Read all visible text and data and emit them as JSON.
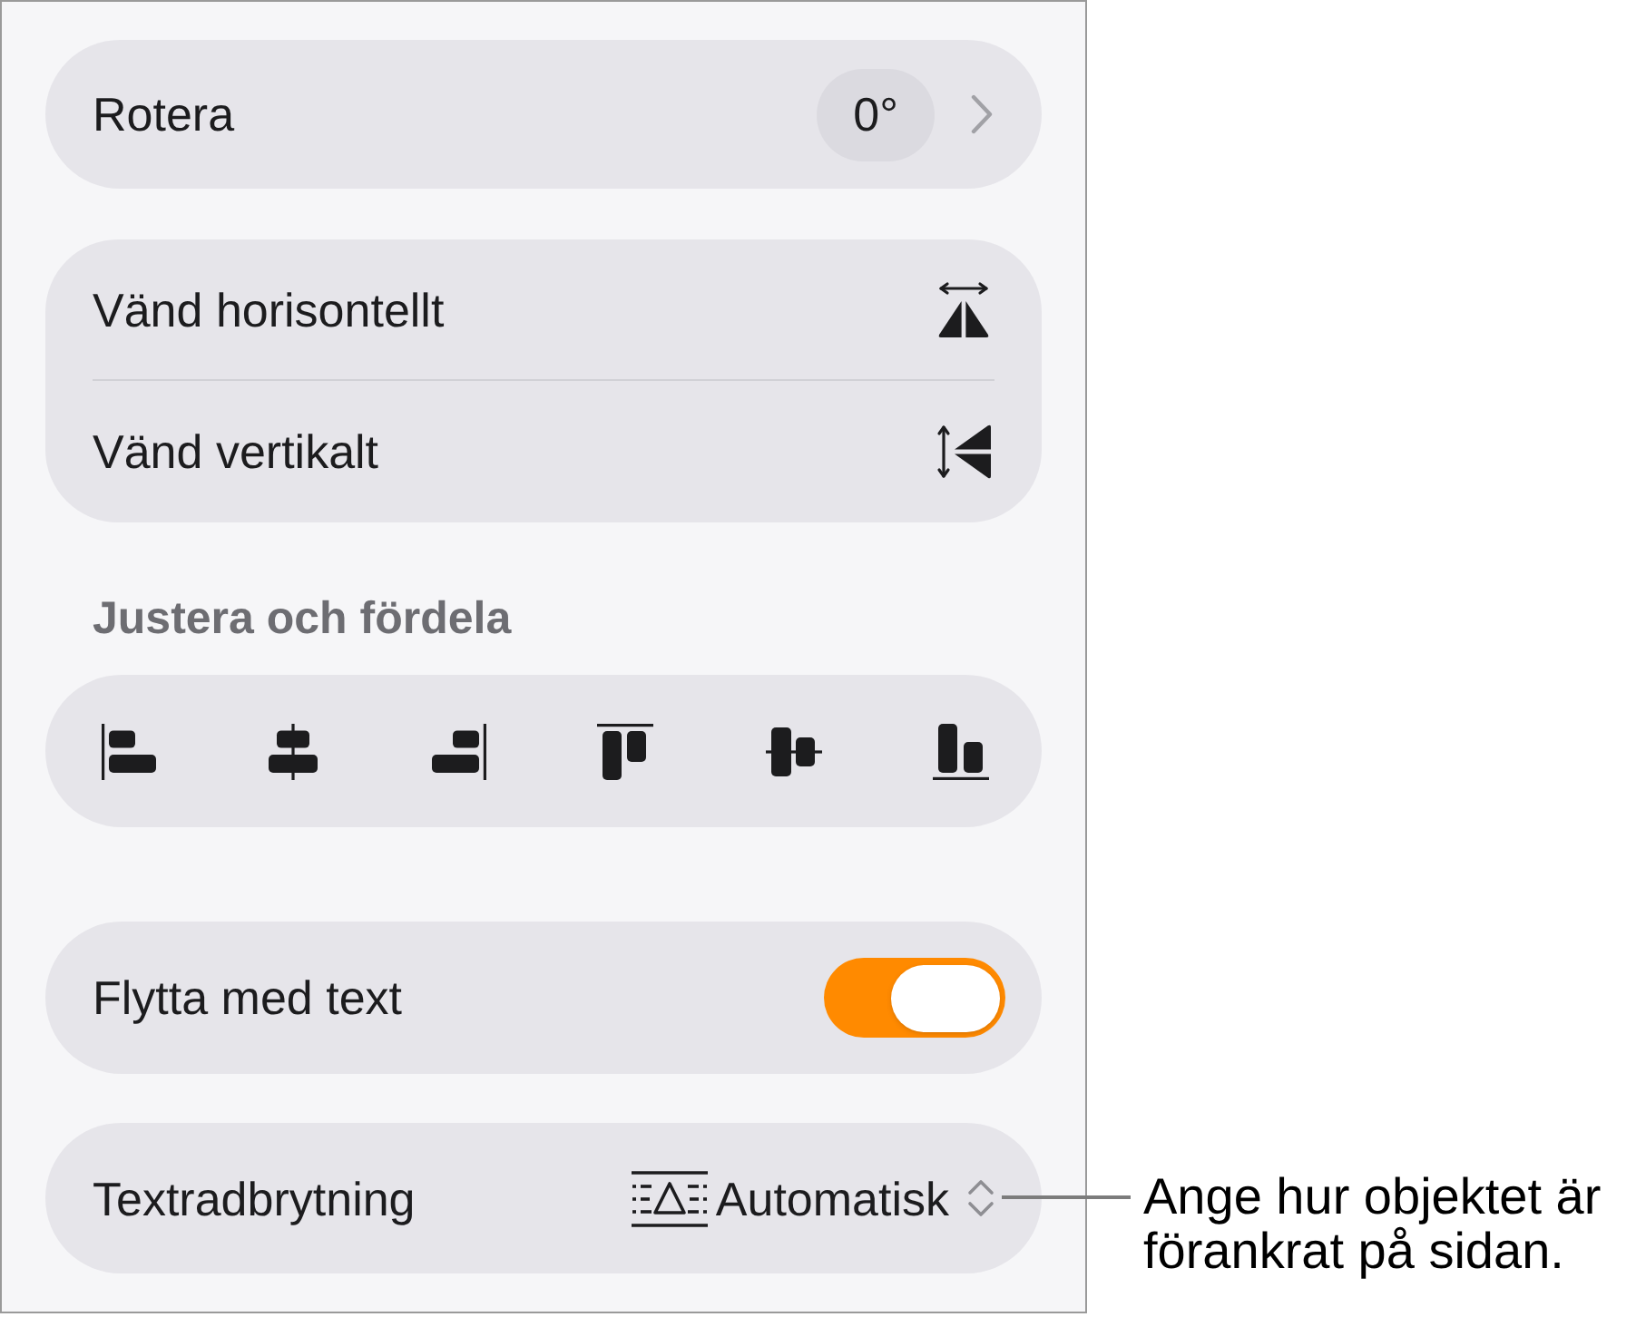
{
  "rotate": {
    "label": "Rotera",
    "value": "0°"
  },
  "flip_items": [
    {
      "label": "Vänd horisontellt"
    },
    {
      "label": "Vänd vertikalt"
    }
  ],
  "arrange": {
    "title": "Justera och fördela"
  },
  "move_with_text": {
    "label": "Flytta med text",
    "on": true
  },
  "text_wrap": {
    "label": "Textradbrytning",
    "value": "Automatisk"
  },
  "callout": "Ange hur objektet är förankrat på sidan."
}
